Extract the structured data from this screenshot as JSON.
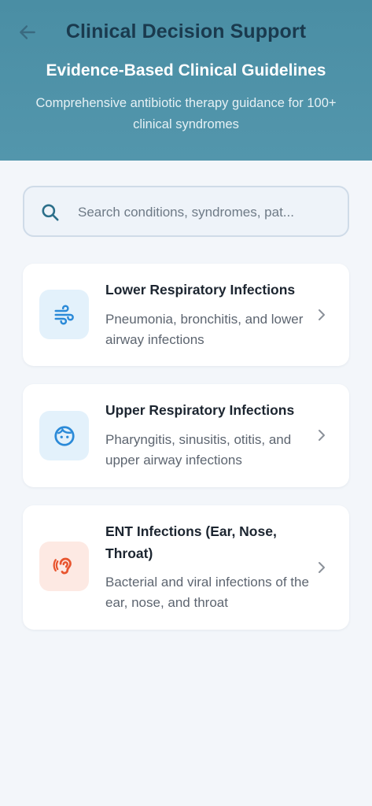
{
  "header": {
    "app_title": "Clinical Decision Support",
    "hero_title": "Evidence-Based Clinical Guidelines",
    "hero_subtitle": "Comprehensive antibiotic therapy guidance for 100+ clinical syndromes"
  },
  "search": {
    "placeholder": "Search conditions, syndromes, pat...",
    "value": ""
  },
  "categories": [
    {
      "title": "Lower Respiratory Infections",
      "description": "Pneumonia, bronchitis, and lower airway infections",
      "icon": "wind-icon",
      "icon_bg": "#e3f1fb",
      "icon_color": "#2b8ad8"
    },
    {
      "title": "Upper Respiratory Infections",
      "description": "Pharyngitis, sinusitis, otitis, and upper airway infections",
      "icon": "face-icon",
      "icon_bg": "#e3f1fb",
      "icon_color": "#2b8ad8"
    },
    {
      "title": "ENT Infections (Ear, Nose, Throat)",
      "description": "Bacterial and viral infections of the ear, nose, and throat",
      "icon": "ear-icon",
      "icon_bg": "#fde9e3",
      "icon_color": "#e8552f"
    }
  ],
  "colors": {
    "header_bg": "#4e92a8",
    "app_title": "#1a3a4e",
    "page_bg": "#f3f6fa"
  }
}
